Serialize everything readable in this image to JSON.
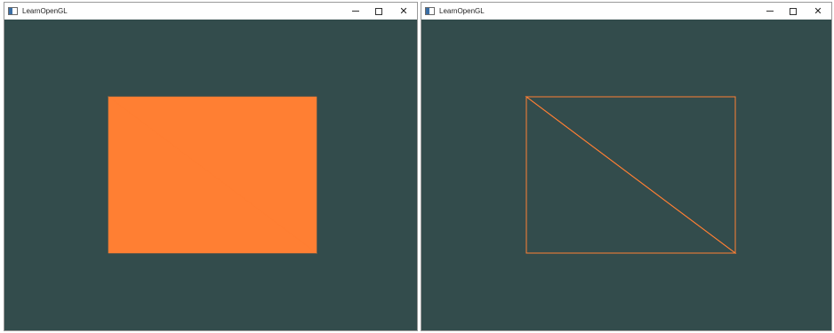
{
  "windows": [
    {
      "title": "LearnOpenGL",
      "render_mode": "fill",
      "clear_color": "#334c4c",
      "object_color": "#ff7f33"
    },
    {
      "title": "LearnOpenGL",
      "render_mode": "wireframe",
      "clear_color": "#334c4c",
      "object_color": "#ff7f33"
    }
  ],
  "title_bar": {
    "minimize_symbol": "–",
    "close_symbol": "✕"
  },
  "icons": {
    "app": "window-app-icon",
    "minimize": "minimize-icon",
    "maximize": "maximize-icon",
    "close": "close-icon"
  }
}
